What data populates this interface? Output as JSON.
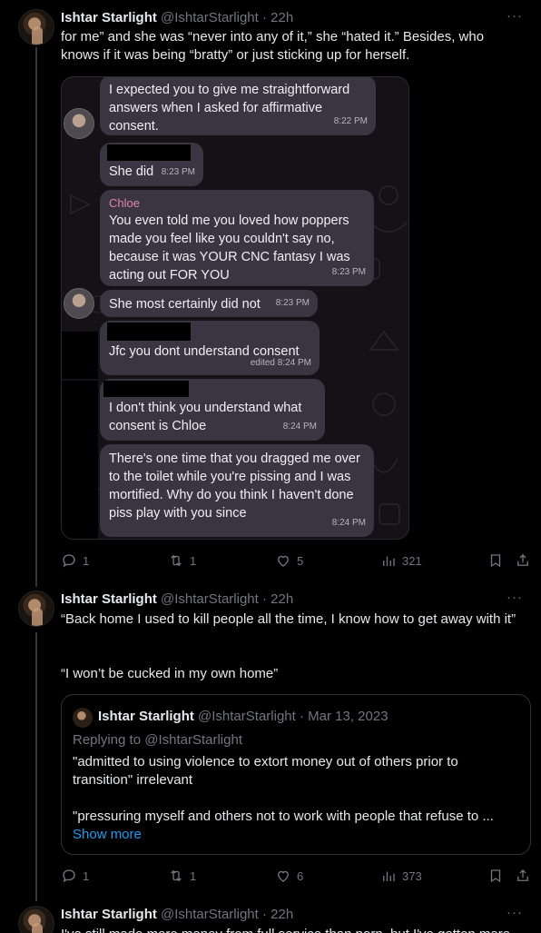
{
  "tweets": [
    {
      "name": "Ishtar Starlight",
      "handle": "@IshtarStarlight",
      "sep": "·",
      "time": "22h",
      "text": "for me” and she was “never into any of it,” she “hated it.” Besides, who knows if it was being “bratty” or just sticking up for herself.",
      "replies": "1",
      "reposts": "1",
      "likes": "5",
      "views": "321"
    },
    {
      "name": "Ishtar Starlight",
      "handle": "@IshtarStarlight",
      "sep": "·",
      "time": "22h",
      "text1": "“Back home I used to kill people all the time, I know how to get away with it”",
      "text2": "“I won’t be cucked in my own home”",
      "replies": "1",
      "reposts": "1",
      "likes": "6",
      "views": "373"
    },
    {
      "name": "Ishtar Starlight",
      "handle": "@IshtarStarlight",
      "sep": "·",
      "time": "22h",
      "text": "I've still made more money from full service than porn, but I've gotten more"
    }
  ],
  "chat": {
    "messages": [
      {
        "text": "I expected you to give me straightforward answers when I asked for affirmative consent.",
        "time": "8:22 PM"
      },
      {
        "text": "She did",
        "time": "8:23 PM"
      },
      {
        "sender": "Chloe",
        "text": "You even told me you loved how poppers made you feel like you couldn't say no, because it was YOUR CNC fantasy I was acting out FOR YOU",
        "time": "8:23 PM"
      },
      {
        "text": "She most certainly did not",
        "time": "8:23 PM"
      },
      {
        "text": "Jfc you dont understand consent",
        "time": "edited 8:24 PM"
      },
      {
        "text": "I don't think you understand what consent is Chloe",
        "time": "8:24 PM"
      },
      {
        "text": "There's one time that you dragged me over to the toilet while you're pissing and I was mortified. Why do you think I haven't done piss play with you since",
        "time": "8:24 PM"
      }
    ]
  },
  "quote": {
    "name": "Ishtar Starlight",
    "handle": "@IshtarStarlight",
    "sep": "·",
    "date": "Mar 13, 2023",
    "replying": "Replying to @IshtarStarlight",
    "text1": "\"admitted to using violence to extort money out of others prior to transition\" irrelevant",
    "text2": "\"pressuring myself and others not to work with people that refuse to ...",
    "show_more": "Show more"
  },
  "ui": {
    "more": "···"
  },
  "colors": {
    "background": "#000000",
    "text": "#e7e9ea",
    "muted": "#71767b",
    "link": "#1d9bf0",
    "bubble": "#3a3540",
    "sender": "#e084b7"
  },
  "icons": [
    "reply-icon",
    "repost-icon",
    "like-icon",
    "views-icon",
    "bookmark-icon",
    "share-icon",
    "more-icon"
  ]
}
